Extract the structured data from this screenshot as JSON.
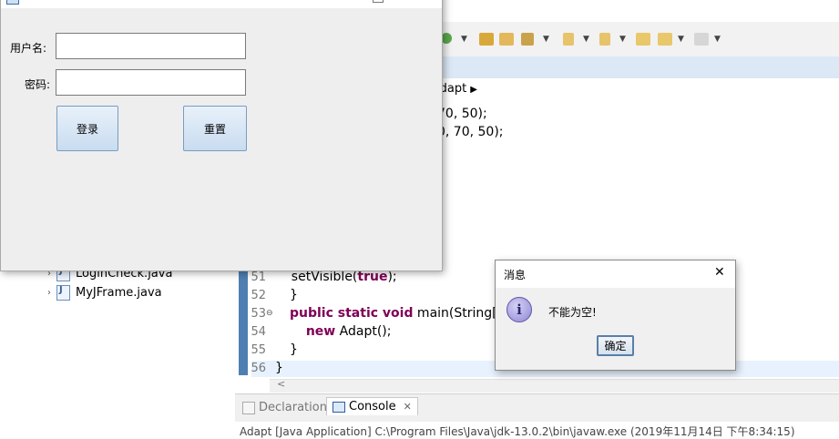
{
  "ide": {
    "breadcrumb": "Adapt",
    "code_lines": [
      {
        "num": "",
        "text": "70, 50);"
      },
      {
        "num": "",
        "text": "0, 70, 50);"
      },
      {
        "num": "51",
        "pre": "    setVisible(",
        "kw": "true",
        "post": ");"
      },
      {
        "num": "52",
        "text": "}"
      },
      {
        "num": "53",
        "kw1": "public static void",
        "post": " main(String[] ar"
      },
      {
        "num": "54",
        "pre": "    ",
        "kw": "new",
        "post": " Adapt();"
      },
      {
        "num": "55",
        "text": "}"
      },
      {
        "num": "56",
        "text": "}"
      }
    ],
    "tree_items": [
      "LoginCheck.java",
      "MyJFrame.java"
    ],
    "panel_tabs": {
      "declaration": "Declaration",
      "console": "Console"
    },
    "console_text": "Adapt [Java Application] C:\\Program Files\\Java\\jdk-13.0.2\\bin\\javaw.exe (2019年11月14日 下午8:34:15)"
  },
  "login": {
    "username_label": "用户名:",
    "password_label": "密码:",
    "username_value": "",
    "password_value": "",
    "login_button": "登录",
    "reset_button": "重置"
  },
  "message": {
    "title": "消息",
    "text": "不能为空!",
    "ok_button": "确定",
    "close_glyph": "✕"
  },
  "colors": {
    "keyword": "#7f0055",
    "button_border": "#7a9cbf",
    "info_icon": "#8e86d6"
  }
}
